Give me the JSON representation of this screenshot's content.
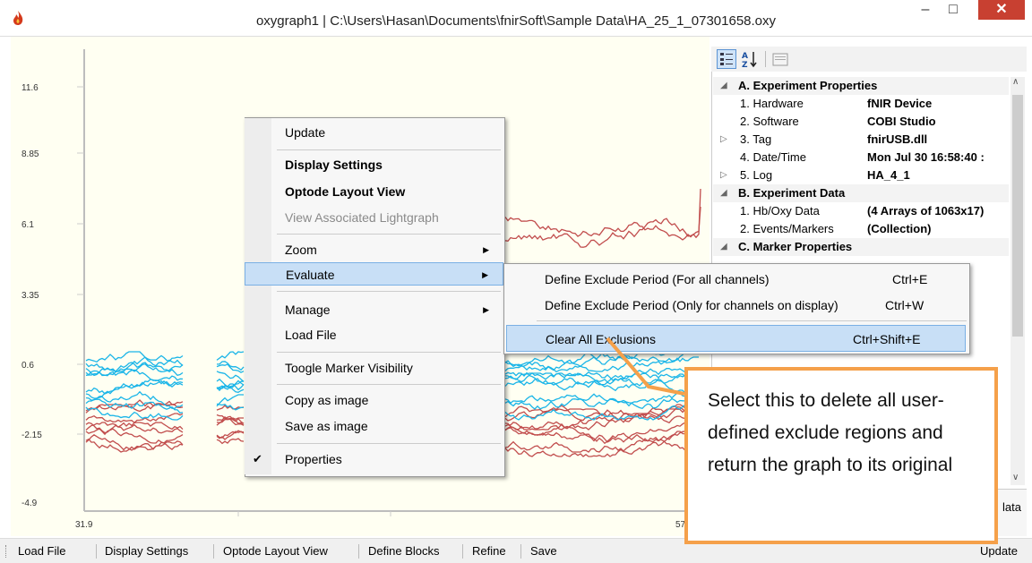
{
  "window": {
    "title": "oxygraph1 | C:\\Users\\Hasan\\Documents\\fnirSoft\\Sample Data\\HA_25_1_07301658.oxy",
    "min_glyph": "–",
    "max_glyph": "□",
    "close_glyph": "✕"
  },
  "plot": {
    "y_ticks": [
      "11.6",
      "8.85",
      "6.1",
      "3.35",
      "0.6",
      "-2.15",
      "-4.9"
    ],
    "x_ticks": [
      "31.9",
      "57"
    ],
    "series_colors": [
      "#c14d4d",
      "#1ab5e8"
    ]
  },
  "property_grid": {
    "rows": [
      {
        "type": "cat",
        "exp": "◢",
        "name": "A. Experiment Properties",
        "value": ""
      },
      {
        "type": "prop",
        "exp": "",
        "name": "1. Hardware",
        "value": "fNIR Device"
      },
      {
        "type": "prop",
        "exp": "",
        "name": "2. Software",
        "value": "COBI Studio"
      },
      {
        "type": "prop",
        "exp": "▷",
        "name": "3. Tag",
        "value": "fnirUSB.dll"
      },
      {
        "type": "prop",
        "exp": "",
        "name": "4. Date/Time",
        "value": "Mon Jul 30 16:58:40 :"
      },
      {
        "type": "prop",
        "exp": "▷",
        "name": "5. Log",
        "value": "HA_4_1"
      },
      {
        "type": "cat",
        "exp": "◢",
        "name": "B. Experiment Data",
        "value": ""
      },
      {
        "type": "prop",
        "exp": "",
        "name": "1. Hb/Oxy Data",
        "value": "(4 Arrays of 1063x17)"
      },
      {
        "type": "prop",
        "exp": "",
        "name": "2. Events/Markers",
        "value": "(Collection)"
      },
      {
        "type": "cat",
        "exp": "◢",
        "name": "C. Marker Properties",
        "value": ""
      }
    ],
    "desc_fragment": "lata"
  },
  "status_bar": {
    "items": [
      "Load File",
      "Display Settings",
      "Optode Layout View",
      "Define Blocks",
      "Refine",
      "Save"
    ],
    "right": "Update"
  },
  "context_menu": {
    "update": "Update",
    "display_settings": "Display Settings",
    "optode_layout": "Optode Layout View",
    "view_lightgraph": "View Associated Lightgraph",
    "zoom": "Zoom",
    "evaluate": "Evaluate",
    "manage": "Manage",
    "load_file": "Load File",
    "toggle_marker": "Toogle Marker Visibility",
    "copy_image": "Copy as image",
    "save_image": "Save as image",
    "properties": "Properties",
    "arrow": "▶",
    "check": "✔"
  },
  "submenu": {
    "items": [
      {
        "label": "Define Exclude Period (For all channels)",
        "shortcut": "Ctrl+E"
      },
      {
        "label": "Define Exclude Period (Only for channels on display)",
        "shortcut": "Ctrl+W"
      },
      {
        "label": "Clear All Exclusions",
        "shortcut": "Ctrl+Shift+E"
      }
    ]
  },
  "callout": {
    "text": "Select this to delete all user-defined exclude regions and return the graph to its original"
  }
}
